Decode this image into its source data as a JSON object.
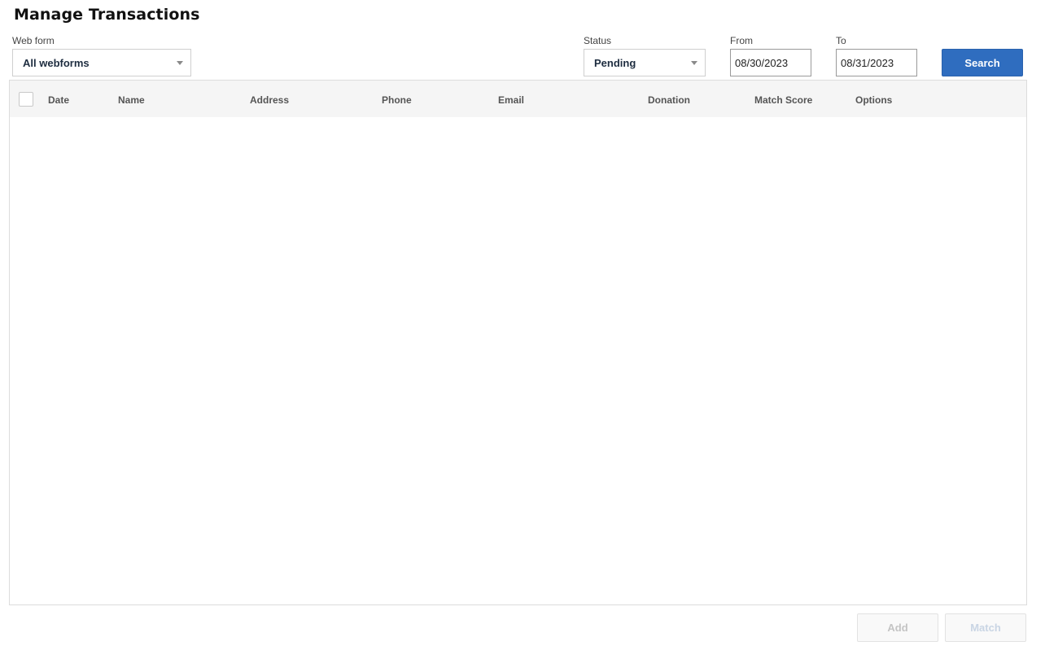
{
  "page": {
    "title": "Manage Transactions"
  },
  "filters": {
    "webform": {
      "label": "Web form",
      "value": "All webforms"
    },
    "status": {
      "label": "Status",
      "value": "Pending"
    },
    "from": {
      "label": "From",
      "value": "08/30/2023"
    },
    "to": {
      "label": "To",
      "value": "08/31/2023"
    },
    "search_label": "Search"
  },
  "table": {
    "columns": [
      "Date",
      "Name",
      "Address",
      "Phone",
      "Email",
      "Donation",
      "Match Score",
      "Options"
    ],
    "rows": []
  },
  "footer": {
    "add_label": "Add",
    "match_label": "Match"
  },
  "colors": {
    "accent": "#2f6dbf",
    "header_bg": "#f5f5f5",
    "border": "#dcdcdc"
  },
  "icons": {
    "dropdown": "chevron-down-icon",
    "select_all": "checkbox-icon"
  }
}
